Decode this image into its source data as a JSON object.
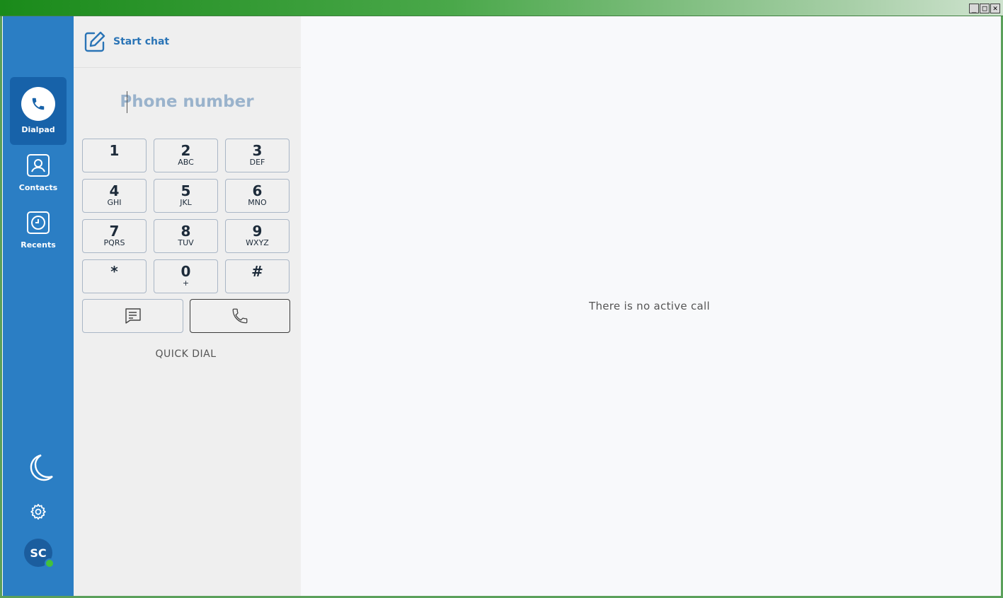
{
  "window": {
    "controls": [
      "_",
      "□",
      "✕"
    ]
  },
  "rail": {
    "items": [
      {
        "label": "Dialpad",
        "icon": "phone-icon",
        "active": true
      },
      {
        "label": "Contacts",
        "icon": "contact-icon",
        "active": false
      },
      {
        "label": "Recents",
        "icon": "clock-icon",
        "active": false
      }
    ],
    "bottom_icons": [
      "moon-icon",
      "gear-icon"
    ],
    "avatar": {
      "initials": "SC",
      "presence": "online",
      "presence_color": "#43c13c"
    },
    "bg_color": "#2b7ec4",
    "active_color": "#1762a9"
  },
  "dialpad": {
    "start_chat": "Start chat",
    "phone_placeholder": "Phone number",
    "phone_value": "",
    "keys": [
      {
        "digit": "1",
        "letters": ""
      },
      {
        "digit": "2",
        "letters": "ABC"
      },
      {
        "digit": "3",
        "letters": "DEF"
      },
      {
        "digit": "4",
        "letters": "GHI"
      },
      {
        "digit": "5",
        "letters": "JKL"
      },
      {
        "digit": "6",
        "letters": "MNO"
      },
      {
        "digit": "7",
        "letters": "PQRS"
      },
      {
        "digit": "8",
        "letters": "TUV"
      },
      {
        "digit": "9",
        "letters": "WXYZ"
      },
      {
        "digit": "*",
        "letters": ""
      },
      {
        "digit": "0",
        "letters": "+"
      },
      {
        "digit": "#",
        "letters": ""
      }
    ],
    "message_button_icon": "message-icon",
    "call_button_icon": "phone-icon",
    "quick_dial": "QUICK DIAL"
  },
  "main": {
    "status": "There is no active call"
  }
}
